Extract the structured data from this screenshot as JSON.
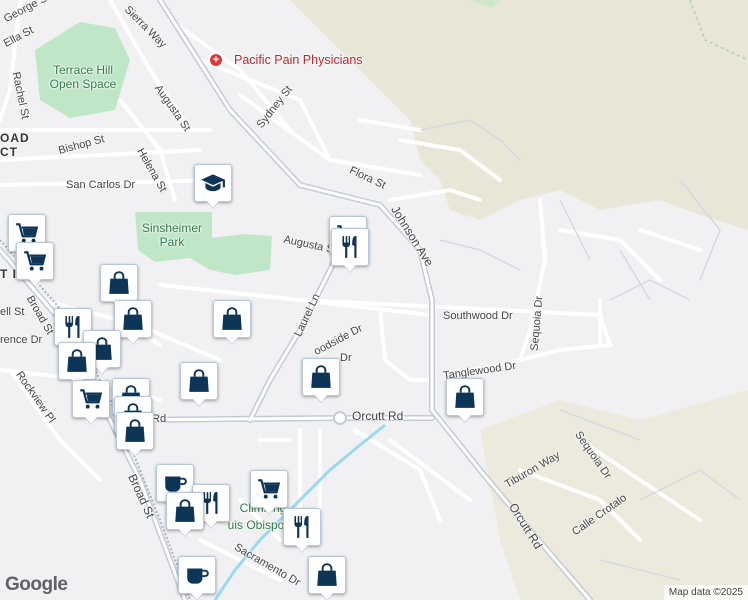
{
  "colors": {
    "background": "#f1f1f3",
    "park": "#bfe6c7",
    "terrain": "#e8e6d6",
    "road": "#ffffff",
    "highway": "#c4cbd4",
    "water": "#9ad9f0",
    "pin_icon": "#0d3557",
    "poi_red": "#d93b3b"
  },
  "streets": [
    {
      "key": "george_st",
      "label": "George St"
    },
    {
      "key": "ella_st",
      "label": "Ella St"
    },
    {
      "key": "sierra_way",
      "label": "Sierra Way"
    },
    {
      "key": "rachel_st",
      "label": "Rachel St"
    },
    {
      "key": "augusta_st_upper",
      "label": "Augusta St"
    },
    {
      "key": "sydney_st",
      "label": "Sydney St"
    },
    {
      "key": "bishop_st",
      "label": "Bishop St"
    },
    {
      "key": "helena_st",
      "label": "Helena St"
    },
    {
      "key": "flora_st",
      "label": "Flora St"
    },
    {
      "key": "san_carlos_dr",
      "label": "San Carlos Dr"
    },
    {
      "key": "johnson_ave",
      "label": "Johnson Ave"
    },
    {
      "key": "augusta_st_lower",
      "label": "Augusta St"
    },
    {
      "key": "laurel_ln",
      "label": "Laurel Ln"
    },
    {
      "key": "southwood_dr",
      "label": "Southwood Dr"
    },
    {
      "key": "sequoia_dr_upper",
      "label": "Sequoia Dr"
    },
    {
      "key": "woodside_dr",
      "label": "oodside Dr"
    },
    {
      "key": "ell_st",
      "label": "ell St"
    },
    {
      "key": "rence_dr",
      "label": "rence Dr"
    },
    {
      "key": "tanglewood_dr",
      "label": "Tanglewood Dr"
    },
    {
      "key": "dr_fragment",
      "label": "Dr"
    },
    {
      "key": "rockview_pl",
      "label": "Rockview Pl"
    },
    {
      "key": "broad_st_upper",
      "label": "Broad St"
    },
    {
      "key": "orcutt_rd_left",
      "label": "Rd"
    },
    {
      "key": "orcutt_rd",
      "label": "Orcutt Rd"
    },
    {
      "key": "tiburon_way",
      "label": "Tiburon Way"
    },
    {
      "key": "sequoia_dr_lower",
      "label": "Sequoia Dr"
    },
    {
      "key": "orcutt_rd_diag",
      "label": "Orcutt Rd"
    },
    {
      "key": "calle_crotalo",
      "label": "Calle Crotalo"
    },
    {
      "key": "broad_st_lower",
      "label": "Broad St"
    },
    {
      "key": "sacramento_dr",
      "label": "Sacramento Dr"
    },
    {
      "key": "fragment_pe",
      "label": "Pe"
    }
  ],
  "areas": {
    "terrace_hill": "Terrace Hill Open Space",
    "sinsheimer": "Sinsheimer Park",
    "district_1": "OAD",
    "district_2": "CT",
    "little_italy": "T ITALY",
    "climbing": "Climbing",
    "obispo": "uis Obispo"
  },
  "poi": {
    "name": "Pacific Pain Physicians"
  },
  "pins": [
    {
      "icon": "school"
    },
    {
      "icon": "shopping-cart"
    },
    {
      "icon": "restaurant"
    },
    {
      "icon": "shopping-cart"
    },
    {
      "icon": "shopping-cart"
    },
    {
      "icon": "shopping-bag"
    },
    {
      "icon": "restaurant"
    },
    {
      "icon": "shopping-bag"
    },
    {
      "icon": "shopping-bag"
    },
    {
      "icon": "shopping-bag"
    },
    {
      "icon": "shopping-bag"
    },
    {
      "icon": "shopping-bag"
    },
    {
      "icon": "shopping-bag"
    },
    {
      "icon": "shopping-cart"
    },
    {
      "icon": "shopping-bag"
    },
    {
      "icon": "shopping-bag"
    },
    {
      "icon": "shopping-bag"
    },
    {
      "icon": "shopping-bag"
    },
    {
      "icon": "coffee"
    },
    {
      "icon": "restaurant"
    },
    {
      "icon": "shopping-cart"
    },
    {
      "icon": "shopping-bag"
    },
    {
      "icon": "restaurant"
    },
    {
      "icon": "coffee"
    },
    {
      "icon": "shopping-bag"
    }
  ],
  "attribution": {
    "logo": "Google",
    "map_data": "Map data ©2025"
  }
}
